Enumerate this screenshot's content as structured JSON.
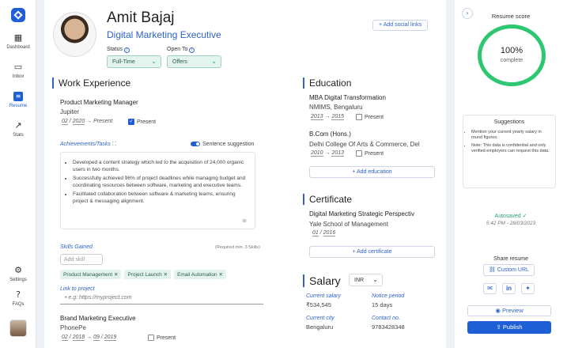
{
  "nav": {
    "items": [
      {
        "label": "Dashboard",
        "icon": "grid-icon"
      },
      {
        "label": "Inbox",
        "icon": "chat-icon"
      },
      {
        "label": "Resume",
        "icon": "document-icon"
      },
      {
        "label": "Stats",
        "icon": "chart-icon"
      }
    ],
    "bottom": [
      {
        "label": "Settings",
        "icon": "gear-icon"
      },
      {
        "label": "FAQs",
        "icon": "help-icon"
      }
    ]
  },
  "profile": {
    "name": "Amit Bajaj",
    "title": "Digital Marketing Executive",
    "status_label": "Status",
    "status_value": "Full-Time",
    "open_to_label": "Open To",
    "open_to_value": "Offers",
    "add_social": "Add social links"
  },
  "work": {
    "title": "Work Experience",
    "job1": {
      "role": "Product Marketing Manager",
      "company": "Jupiter",
      "start_month": "02",
      "start_year": "2020",
      "end": "Present",
      "present_label": "Present",
      "achievements_label": "Achievements/Tasks",
      "sentence_suggestion": "Sentence suggestion",
      "bullets": [
        "Developed a content strategy which led to the acquisition of 24,000 organic users in two months.",
        "Successfully achieved 96% of project deadlines while managing budget and coordinating resources between software, marketing and executive teams.",
        "Facilitated collaboration between software & marketing teams, ensuring project & messaging alignment."
      ],
      "skills_label": "Skills Gained",
      "skills_required": "(Required min. 3 Skills)",
      "add_skill_placeholder": "Add skill",
      "skills": [
        "Product Management",
        "Project Launch",
        "Email Automation"
      ],
      "link_label": "Link to project",
      "link_placeholder": "e.g: https://myproject.com"
    },
    "job2": {
      "role": "Brand Marketing Executive",
      "company": "PhonePe",
      "start_month": "02",
      "start_year": "2018",
      "end_month": "09",
      "end_year": "2019",
      "present_label": "Present"
    }
  },
  "education": {
    "title": "Education",
    "items": [
      {
        "degree": "MBA Digital Transformation",
        "school": "NMIMS, Bengaluru",
        "start": "2013",
        "end": "2015",
        "present_label": "Present"
      },
      {
        "degree": "B.Com (Hons.)",
        "school": "Delhi College Of Arts & Commerce, Del",
        "start": "2010",
        "end": "2013",
        "present_label": "Present"
      }
    ],
    "add_label": "Add education"
  },
  "certificate": {
    "title": "Certificate",
    "name": "Digital Marketing Strategic Perspectiv",
    "org": "Yale School of Management",
    "month": "01",
    "year": "2016",
    "add_label": "Add certificate"
  },
  "salary": {
    "title": "Salary",
    "currency": "INR",
    "current_label": "Current salary",
    "current_value": "₹534,545",
    "notice_label": "Notice period",
    "notice_value": "15  days",
    "city_label": "Current city",
    "city_value": "Bengaluru",
    "contact_label": "Contact no.",
    "contact_value": "9783428348"
  },
  "score": {
    "title": "Resume score",
    "percent": "100%",
    "status": "complete",
    "value": 1.0,
    "ring_color": "#2ec771"
  },
  "suggestions": {
    "title": "Suggestions",
    "items": [
      "Mention your current yearly salary in round figures.",
      "Note: This data is confidential and only verified employers can request this data."
    ]
  },
  "autosave": {
    "label": "Autosaved",
    "time": "5:42 PM - 28/03/2023"
  },
  "share": {
    "title": "Share resume",
    "custom_url": "Custom URL"
  },
  "actions": {
    "preview": "Preview",
    "publish": "Publish"
  },
  "colors": {
    "accent": "#1f5fd6",
    "success": "#2ec771"
  }
}
